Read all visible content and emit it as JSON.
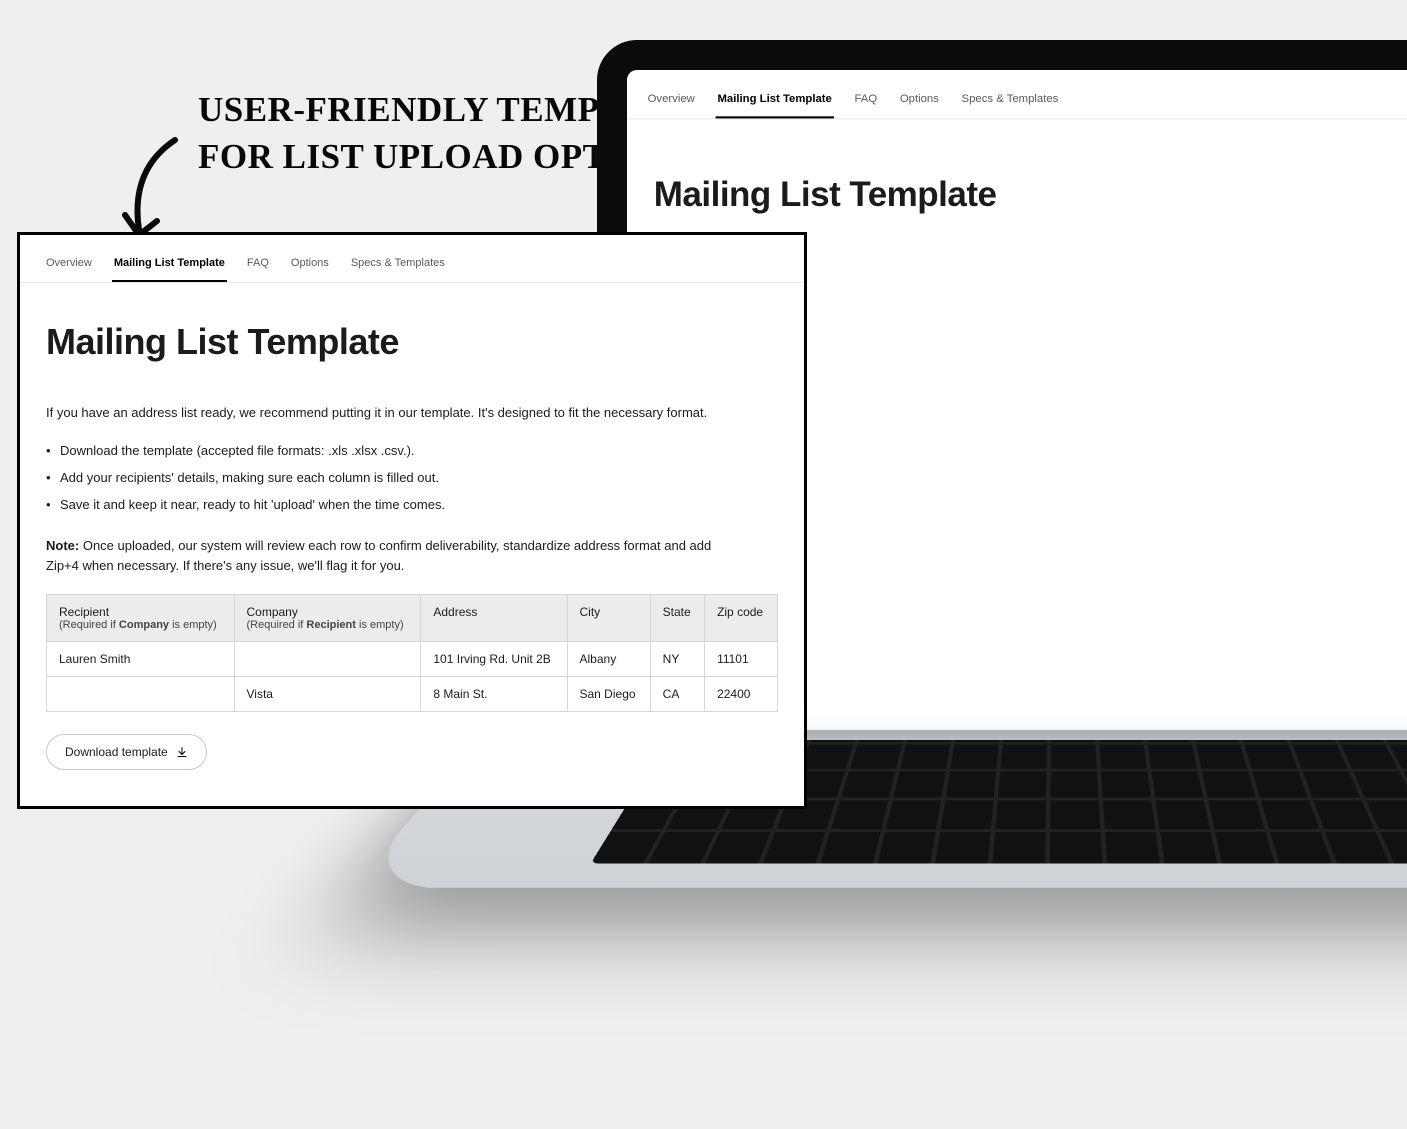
{
  "annotation": {
    "line1": "User-friendly Template",
    "line2": "for List Upload Option"
  },
  "tabs": [
    {
      "label": "Overview",
      "active": false
    },
    {
      "label": "Mailing List Template",
      "active": true
    },
    {
      "label": "FAQ",
      "active": false
    },
    {
      "label": "Options",
      "active": false
    },
    {
      "label": "Specs & Templates",
      "active": false
    }
  ],
  "page": {
    "title": "Mailing List Template",
    "intro": "If you have an address list ready, we recommend putting it in our template. It's designed to fit the necessary format.",
    "bullets": [
      "Download the template (accepted file formats: .xls .xlsx .csv.).",
      "Add your recipients' details, making sure each column is filled out.",
      "Save it and keep it near, ready to hit 'upload' when the time comes."
    ],
    "note_label": "Note:",
    "note_body": "Once uploaded, our system will review each row to confirm deliverability, standardize address format and add Zip+4 when necessary. If there's any issue, we'll flag it for you."
  },
  "table": {
    "columns": [
      {
        "main": "Recipient",
        "sub_prefix": "(Required if ",
        "sub_bold": "Company",
        "sub_suffix": " is empty)"
      },
      {
        "main": "Company",
        "sub_prefix": "(Required if ",
        "sub_bold": "Recipient",
        "sub_suffix": " is empty)"
      },
      {
        "main": "Address"
      },
      {
        "main": "City"
      },
      {
        "main": "State"
      },
      {
        "main": "Zip code"
      }
    ],
    "rows": [
      {
        "recipient": "Lauren Smith",
        "company": "",
        "address": "101 Irving Rd. Unit 2B",
        "city": "Albany",
        "state": "NY",
        "zip": "11101"
      },
      {
        "recipient": "",
        "company": "Vista",
        "address": "8 Main St.",
        "city": "San Diego",
        "state": "CA",
        "zip": "22400"
      }
    ]
  },
  "download_button": {
    "label": "Download template"
  }
}
